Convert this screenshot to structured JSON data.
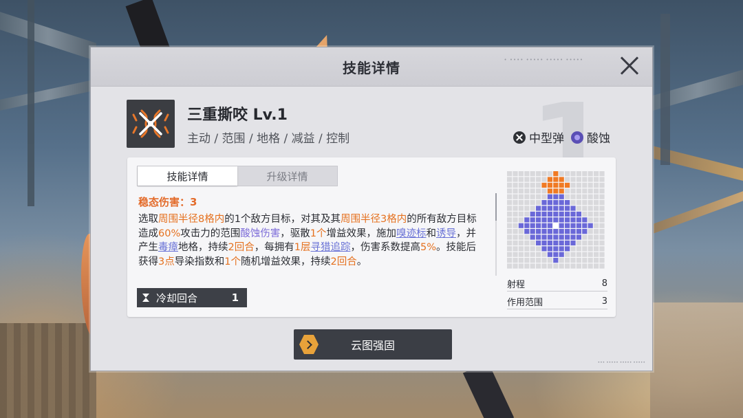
{
  "modal": {
    "title": "技能详情"
  },
  "skill": {
    "name": "三重撕咬 Lv.1",
    "tags": "主动 / 范围 / 地格 / 减益 / 控制",
    "ammo": [
      {
        "icon": "x-mark-icon",
        "label": "中型弹"
      },
      {
        "icon": "acid-icon",
        "label": "酸蚀"
      }
    ]
  },
  "tabs": [
    {
      "label": "技能详情",
      "active": true
    },
    {
      "label": "升级详情",
      "active": false
    }
  ],
  "stable_damage": "稳态伤害：3",
  "description": {
    "s1": "选取",
    "h1": "周围半径8格内",
    "s2": "的1个敌方目标，对其及其",
    "h2": "周围半径3格内",
    "s3": "的所有敌方目标造成",
    "h3": "60%",
    "s4": "攻击力的范围",
    "h4": "酸蚀伤害",
    "s5": "，驱散",
    "h5": "1个",
    "s6": "增益效果，施加",
    "l1": "嗅迹标",
    "s7": "和",
    "l2": "诱导",
    "s8": "，并产生",
    "l3": "毒瘴",
    "s9": "地格，持续",
    "h6": "2回合",
    "s10": "，每拥有",
    "h7": "1层",
    "l4": "寻猎追踪",
    "s11": "，伤害系数提高",
    "h8": "5%",
    "s12": "。技能后获得",
    "h9": "3点",
    "s13": "导染指数和",
    "h10": "1个",
    "s14": "随机增益效果，持续",
    "h11": "2回合",
    "s15": "。"
  },
  "cooldown": {
    "label": "冷却回合",
    "value": "1"
  },
  "range": {
    "range_label": "射程",
    "range_value": "8",
    "area_label": "作用范围",
    "area_value": "3"
  },
  "enhance_button": "云图强固",
  "watermark": "1",
  "colors": {
    "highlight_orange": "#e5711f",
    "highlight_purple": "#7b6ad8",
    "grid_blue": "#6a68d8",
    "grid_orange": "#f07a24",
    "enhance_accent": "#e8a23a"
  }
}
